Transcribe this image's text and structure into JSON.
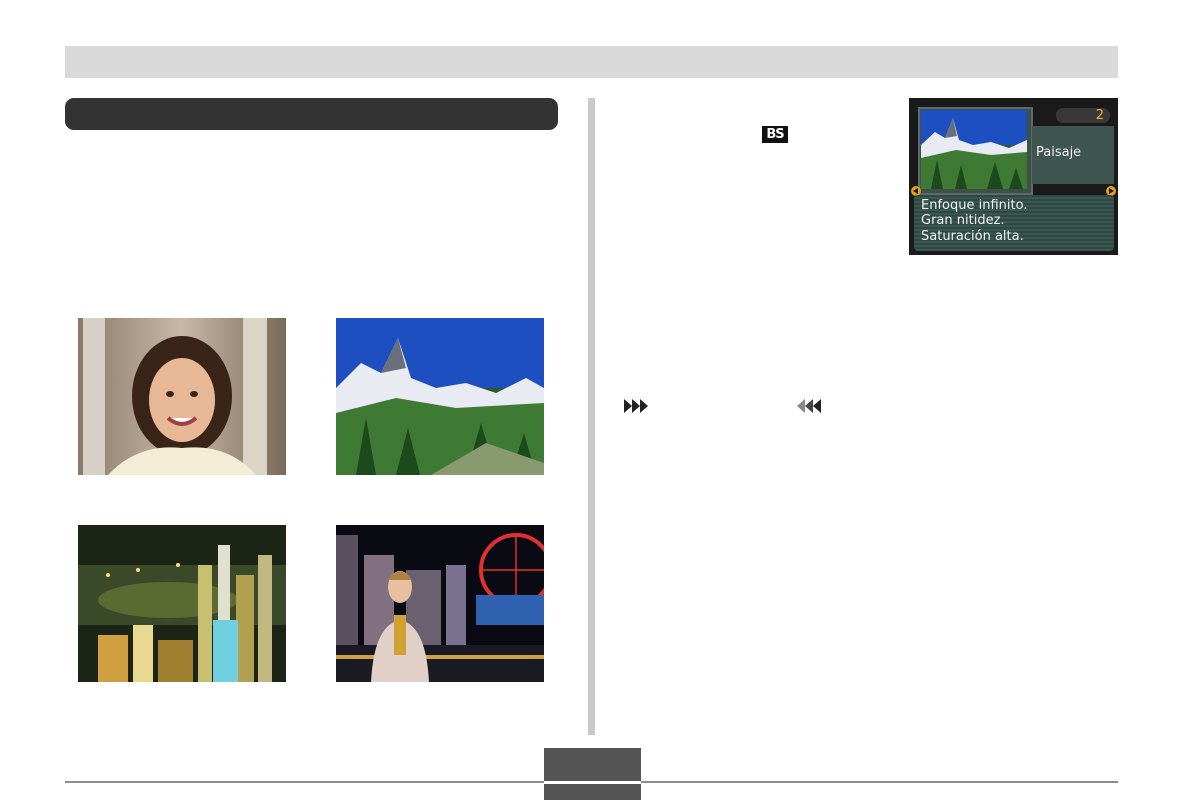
{
  "camera_screen": {
    "number": "2",
    "mode_label": "Paisaje",
    "description_lines": [
      "Enfoque infinito.",
      "Gran nitidez.",
      "Saturación alta."
    ]
  },
  "badge": {
    "label": "BS"
  },
  "photos": [
    {
      "name": "portrait"
    },
    {
      "name": "landscape"
    },
    {
      "name": "night-scene"
    },
    {
      "name": "night-portrait"
    }
  ],
  "colors": {
    "accent_orange": "#e0a020",
    "header_dark": "#333333",
    "top_bar": "#d9d9d9"
  }
}
